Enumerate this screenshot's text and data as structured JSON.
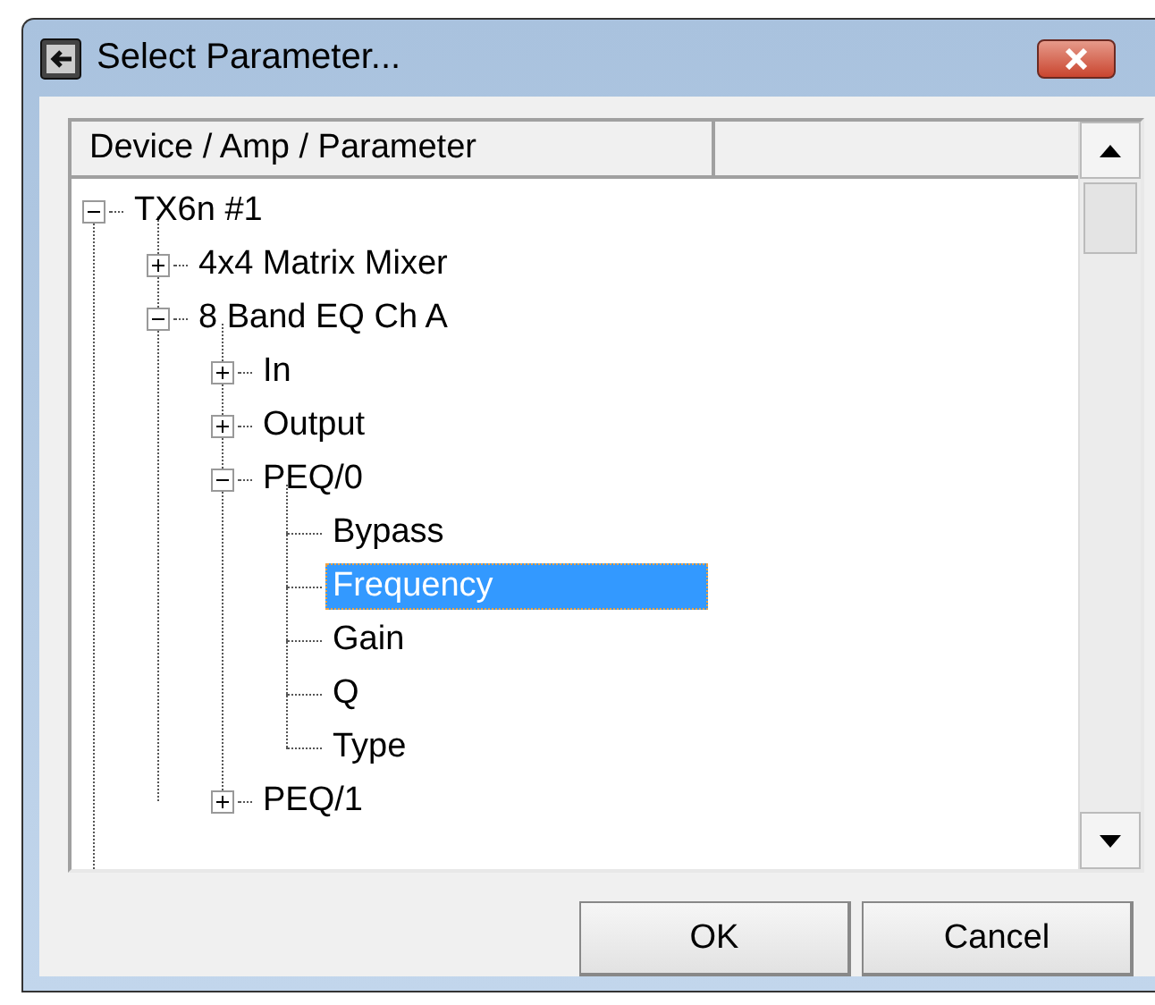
{
  "window": {
    "title": "Select Parameter..."
  },
  "table": {
    "columns": [
      "Device / Amp / Parameter"
    ]
  },
  "tree": [
    {
      "label": "TX6n #1",
      "expanded": true,
      "selected": false,
      "children": [
        {
          "label": "4x4 Matrix Mixer",
          "expanded": false,
          "selected": false
        },
        {
          "label": "8 Band EQ  Ch A",
          "expanded": true,
          "selected": false,
          "children": [
            {
              "label": "In",
              "expanded": false,
              "selected": false
            },
            {
              "label": "Output",
              "expanded": false,
              "selected": false
            },
            {
              "label": "PEQ/0",
              "expanded": true,
              "selected": false,
              "children": [
                {
                  "label": "Bypass",
                  "selected": false
                },
                {
                  "label": "Frequency",
                  "selected": true
                },
                {
                  "label": "Gain",
                  "selected": false
                },
                {
                  "label": "Q",
                  "selected": false
                },
                {
                  "label": "Type",
                  "selected": false
                }
              ]
            },
            {
              "label": "PEQ/1",
              "expanded": false,
              "selected": false
            }
          ]
        }
      ]
    }
  ],
  "buttons": [
    "OK",
    "Cancel"
  ]
}
